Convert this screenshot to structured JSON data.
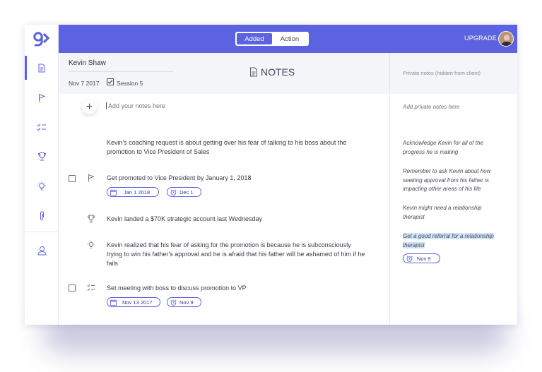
{
  "topbar": {
    "tabs": [
      {
        "label": "Added",
        "active": true
      },
      {
        "label": "Action",
        "active": false
      }
    ],
    "upgrade_label": "UPGRADE"
  },
  "sidebar": {
    "items": [
      {
        "name": "notes",
        "icon": "document-icon",
        "active": true
      },
      {
        "name": "goals",
        "icon": "flag-icon",
        "active": false
      },
      {
        "name": "tasks",
        "icon": "checklist-icon",
        "active": false
      },
      {
        "name": "wins",
        "icon": "trophy-icon",
        "active": false
      },
      {
        "name": "insights",
        "icon": "lightbulb-icon",
        "active": false
      },
      {
        "name": "attachments",
        "icon": "paperclip-icon",
        "active": false
      },
      {
        "name": "profile",
        "icon": "user-icon",
        "active": false
      }
    ]
  },
  "client": {
    "name": "Kevin Shaw",
    "date": "Nov 7 2017",
    "session": "Session 5"
  },
  "notes": {
    "title": "NOTES",
    "placeholder": "Add your notes here",
    "items": [
      {
        "type": "note",
        "text_1": "Kevin's coaching request is about getting over his fear of talking to his boss about the",
        "text_2": "promotion to Vice President of Sales"
      },
      {
        "type": "goal",
        "text": "Get promoted to Vice President by January 1, 2018",
        "start": "Jan 1 2018",
        "reminder": "Dec 1"
      },
      {
        "type": "win",
        "text": "Kevin landed a $70K strategic account last Wednesday"
      },
      {
        "type": "insight",
        "text_1": "Kevin realized that his fear of asking for the promotion is because he is subconsciously",
        "text_2": "trying to win his father's approval and he is afraid that his father will be ashamed of him if he",
        "text_3": "fails"
      },
      {
        "type": "task",
        "text": "Set meeting with boss to discuss promotion to VP",
        "start": "Nov 13 2017",
        "reminder": "Nov 9"
      }
    ]
  },
  "private": {
    "header": "Private notes (hidden from client)",
    "placeholder": "Add private notes here",
    "items": [
      {
        "line_1": "Acknowledge Kevin for all of the",
        "line_2": "progress he is making"
      },
      {
        "line_1": "Remember to ask Kevin about how",
        "line_2": "seeking approval from his father is",
        "line_3": "impacting other areas of his life"
      },
      {
        "line_1": "Kevin might need a relationship",
        "line_2": "therapist"
      },
      {
        "line_1": "Get a good referral for a relationship",
        "line_2": "therapist",
        "reminder": "Nov 9",
        "highlighted": true
      }
    ]
  },
  "colors": {
    "accent": "#5b63e0",
    "highlight": "#cfe4f7"
  }
}
